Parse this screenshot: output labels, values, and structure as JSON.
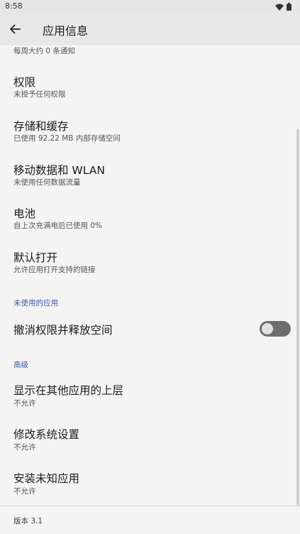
{
  "status_bar": {
    "time": "8:58",
    "icons": [
      "wifi-icon",
      "battery-icon"
    ]
  },
  "app_bar": {
    "title": "应用信息",
    "back_icon": "back-arrow-icon"
  },
  "rows": {
    "notifications_partial": {
      "subtitle": "每周大约 0 条通知"
    },
    "permissions": {
      "title": "权限",
      "subtitle": "未授予任何权限"
    },
    "storage": {
      "title": "存储和缓存",
      "subtitle": "已使用 92.22 MB 内部存储空间"
    },
    "mobile_data": {
      "title": "移动数据和 WLAN",
      "subtitle": "未使用任何数据流量"
    },
    "battery": {
      "title": "电池",
      "subtitle": "自上次充满电后已使用 0%"
    },
    "open_by_default": {
      "title": "默认打开",
      "subtitle": "允许应用打开支持的链接"
    },
    "revoke_permissions": {
      "title": "撤消权限并释放空间",
      "toggle_on": false
    },
    "display_over_apps": {
      "title": "显示在其他应用的上层",
      "subtitle": "不允许"
    },
    "modify_system_settings": {
      "title": "修改系统设置",
      "subtitle": "不允许"
    },
    "install_unknown_apps": {
      "title": "安装未知应用",
      "subtitle": "不允许"
    }
  },
  "sections": {
    "unused_apps": "未使用的应用",
    "advanced": "高级"
  },
  "footer": {
    "version": "版本 3.1"
  },
  "colors": {
    "section_header": "#3f5aa8",
    "toggle_off": "#6e6e6e",
    "background": "#f4f4f4"
  }
}
